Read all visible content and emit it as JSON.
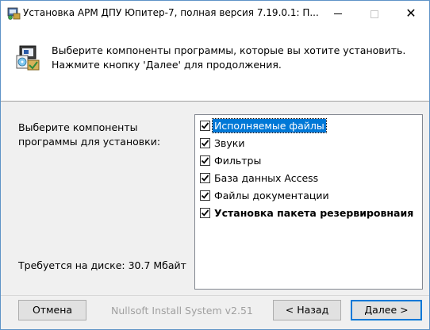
{
  "window": {
    "title": "Установка АРМ ДПУ Юпитер-7, полная версия 7.19.0.1: П...",
    "minimize_icon": "minimize-icon",
    "maximize_icon": "maximize-icon",
    "close_glyph": "✕"
  },
  "header": {
    "line1": "Выберите компоненты программы, которые вы хотите установить.",
    "line2": "Нажмите кнопку 'Далее' для продолжения.",
    "icon": "installer-components-icon"
  },
  "components": {
    "prompt_line1": "Выберите компоненты",
    "prompt_line2": "программы для установки:",
    "disk_space": "Требуется на диске: 30.7 Мбайт",
    "items": [
      {
        "label": "Исполняемые файлы",
        "checked": true,
        "selected": true,
        "bold": false
      },
      {
        "label": "Звуки",
        "checked": true,
        "selected": false,
        "bold": false
      },
      {
        "label": "Фильтры",
        "checked": true,
        "selected": false,
        "bold": false
      },
      {
        "label": "База данных Access",
        "checked": true,
        "selected": false,
        "bold": false
      },
      {
        "label": "Файлы документации",
        "checked": true,
        "selected": false,
        "bold": false
      },
      {
        "label": "Установка пакета резервировнаия",
        "checked": true,
        "selected": false,
        "bold": true
      }
    ]
  },
  "footer": {
    "cancel_label": "Отмена",
    "branding": "Nullsoft Install System v2.51",
    "back_label": "< Назад",
    "next_label": "Далее >"
  },
  "colors": {
    "selection": "#0078d7",
    "default_button_border": "#0078d7"
  }
}
